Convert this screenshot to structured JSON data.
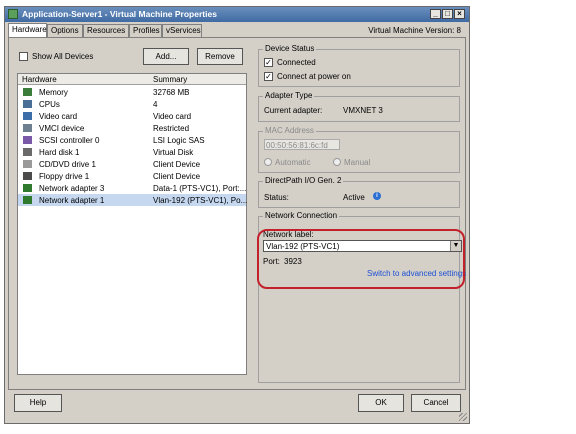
{
  "window": {
    "title": "Application-Server1 - Virtual Machine Properties",
    "vm_version": "Virtual Machine Version: 8",
    "controls": [
      "_",
      "□",
      "×"
    ]
  },
  "tabs": [
    "Hardware",
    "Options",
    "Resources",
    "Profiles",
    "vServices"
  ],
  "hardware": {
    "show_all_label": "Show All Devices",
    "add_label": "Add...",
    "remove_label": "Remove",
    "col_hardware": "Hardware",
    "col_summary": "Summary",
    "rows": [
      {
        "name": "Memory",
        "summary": "32768 MB",
        "icon": "memory-icon",
        "color": "#3a7d3a"
      },
      {
        "name": "CPUs",
        "summary": "4",
        "icon": "cpu-icon",
        "color": "#4a6e96"
      },
      {
        "name": "Video card",
        "summary": "Video card",
        "icon": "video-card-icon",
        "color": "#3b6ea8"
      },
      {
        "name": "VMCI device",
        "summary": "Restricted",
        "icon": "vmci-icon",
        "color": "#6e7f8f"
      },
      {
        "name": "SCSI controller 0",
        "summary": "LSI Logic SAS",
        "icon": "scsi-icon",
        "color": "#7a5aa8"
      },
      {
        "name": "Hard disk 1",
        "summary": "Virtual Disk",
        "icon": "hard-disk-icon",
        "color": "#6a6a6a"
      },
      {
        "name": "CD/DVD drive 1",
        "summary": "Client Device",
        "icon": "cd-dvd-icon",
        "color": "#9a9a9a"
      },
      {
        "name": "Floppy drive 1",
        "summary": "Client Device",
        "icon": "floppy-icon",
        "color": "#4b4b4b"
      },
      {
        "name": "Network adapter 3",
        "summary": "Data-1 (PTS-VC1), Port:...",
        "icon": "network-adapter-icon",
        "color": "#2f7a2f"
      },
      {
        "name": "Network adapter 1",
        "summary": "Vlan-192 (PTS-VC1), Po...",
        "icon": "network-adapter-icon",
        "color": "#2f7a2f"
      }
    ]
  },
  "device_status": {
    "title": "Device Status",
    "connected": "Connected",
    "connect_at_power_on": "Connect at power on"
  },
  "adapter_type": {
    "title": "Adapter Type",
    "label": "Current adapter:",
    "value": "VMXNET 3"
  },
  "mac": {
    "title": "MAC Address",
    "value": "00:50:56:81:6c:fd",
    "automatic": "Automatic",
    "manual": "Manual"
  },
  "directpath": {
    "title": "DirectPath I/O Gen. 2",
    "status_label": "Status:",
    "status_value": "Active",
    "info": "i"
  },
  "network_connection": {
    "title": "Network Connection",
    "label": "Network label:",
    "value": "Vlan-192 (PTS-VC1)",
    "port_label": "Port:",
    "port_value": "3923",
    "advanced_link": "Switch to advanced settings"
  },
  "footer": {
    "help": "Help",
    "ok": "OK",
    "cancel": "Cancel"
  },
  "colors": {
    "titlebar": "#3f6aa3",
    "highlight": "#c2202a",
    "link": "#1c4fd6",
    "selection": "#c5d8f0"
  }
}
